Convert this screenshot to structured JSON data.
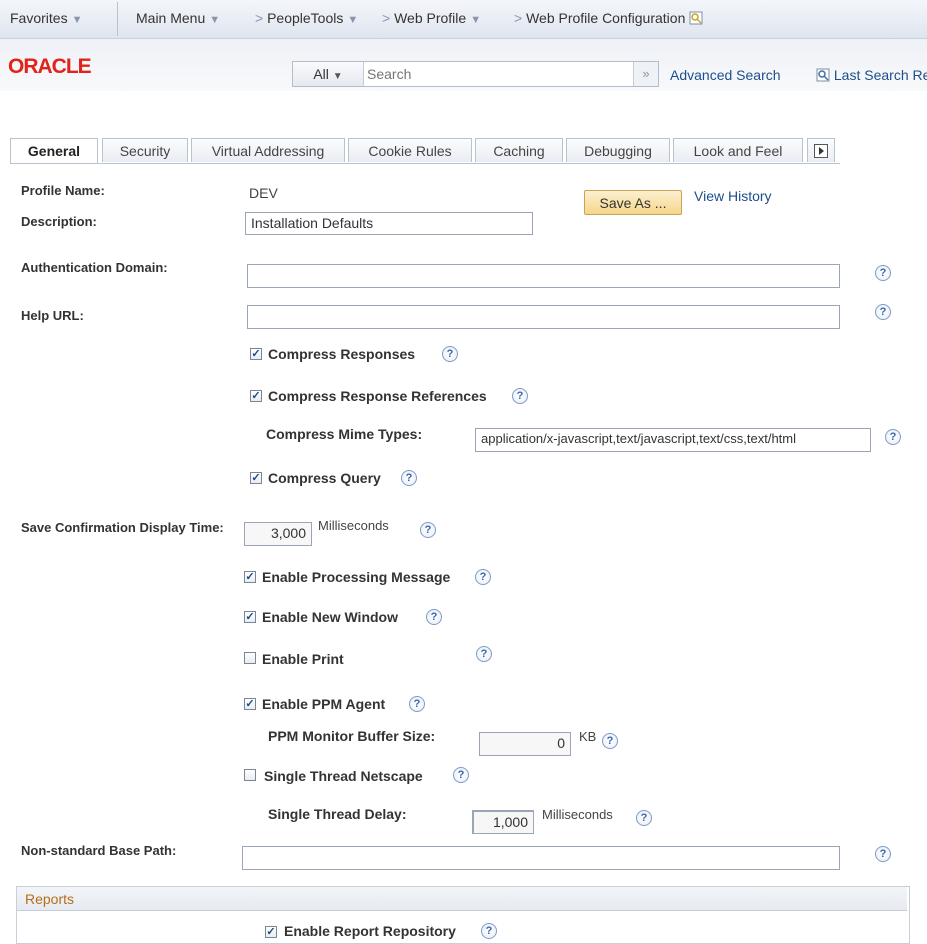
{
  "nav": {
    "favorites": "Favorites",
    "main_menu": "Main Menu",
    "crumbs": [
      "PeopleTools",
      "Web Profile",
      "Web Profile Configuration"
    ]
  },
  "header": {
    "logo": "ORACLE",
    "search_scope": "All",
    "search_placeholder": "Search",
    "advanced_search": "Advanced Search",
    "last_search": "Last Search Results"
  },
  "tabs": [
    "General",
    "Security",
    "Virtual Addressing",
    "Cookie Rules",
    "Caching",
    "Debugging",
    "Look and Feel"
  ],
  "form": {
    "profile_name_label": "Profile Name:",
    "profile_name_value": "DEV",
    "description_label": "Description:",
    "description_value": "Installation Defaults",
    "save_as": "Save As ...",
    "view_history": "View History",
    "auth_domain_label": "Authentication Domain:",
    "auth_domain_value": "",
    "help_url_label": "Help URL:",
    "help_url_value": "",
    "compress_responses": {
      "label": "Compress Responses",
      "checked": true
    },
    "compress_response_refs": {
      "label": "Compress Response References",
      "checked": true
    },
    "compress_mime_label": "Compress Mime Types:",
    "compress_mime_value": "application/x-javascript,text/javascript,text/css,text/html",
    "compress_query": {
      "label": "Compress Query",
      "checked": true
    },
    "save_confirm_label": "Save Confirmation Display Time:",
    "save_confirm_value": "3,000",
    "milliseconds": "Milliseconds",
    "enable_processing": {
      "label": "Enable Processing Message",
      "checked": true
    },
    "enable_new_window": {
      "label": "Enable New Window",
      "checked": true
    },
    "enable_print": {
      "label": "Enable Print",
      "checked": false
    },
    "enable_ppm": {
      "label": "Enable PPM Agent",
      "checked": true
    },
    "ppm_buffer_label": "PPM Monitor Buffer Size:",
    "ppm_buffer_value": "0",
    "kb": "KB",
    "single_thread": {
      "label": "Single Thread Netscape",
      "checked": false
    },
    "single_thread_delay_label": "Single Thread Delay:",
    "single_thread_delay_value": "1,000",
    "nonstd_base_label": "Non-standard Base Path:",
    "nonstd_base_value": ""
  },
  "reports": {
    "title": "Reports",
    "enable_report_repo": {
      "label": "Enable Report Repository",
      "checked": true
    }
  },
  "help_glyph": "?",
  "check_glyph": "✓"
}
